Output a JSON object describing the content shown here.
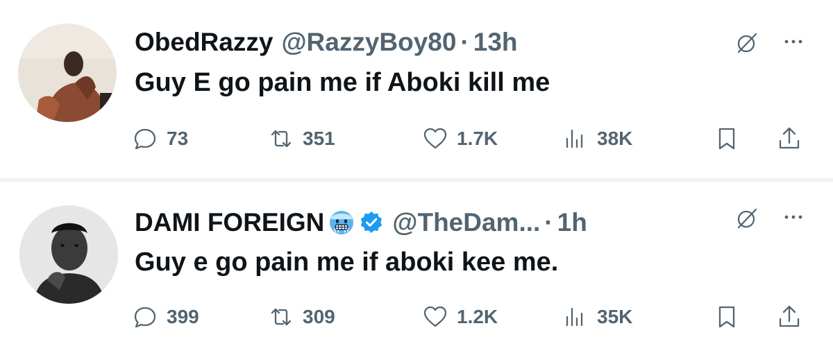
{
  "tweets": [
    {
      "display_name": "ObedRazzy",
      "handle": "@RazzyBoy80",
      "separator": "·",
      "time": "13h",
      "text": "Guy E go pain me if Aboki kill me",
      "stats": {
        "replies": "73",
        "reposts": "351",
        "likes": "1.7K",
        "views": "38K"
      },
      "avatar_icon": "person-photo-avatar",
      "badges": []
    },
    {
      "display_name": "DAMI FOREIGN",
      "handle": "@TheDam...",
      "separator": "·",
      "time": "1h",
      "text": "Guy e go pain me if aboki kee me.",
      "stats": {
        "replies": "399",
        "reposts": "309",
        "likes": "1.2K",
        "views": "35K"
      },
      "avatar_icon": "person-photo-avatar",
      "badges": [
        "cold-face-emoji",
        "verified-badge-icon"
      ]
    }
  ],
  "colors": {
    "text_primary": "#0f1419",
    "text_secondary": "#536471",
    "verified_blue": "#1d9bf0",
    "divider": "#eff3f4"
  }
}
